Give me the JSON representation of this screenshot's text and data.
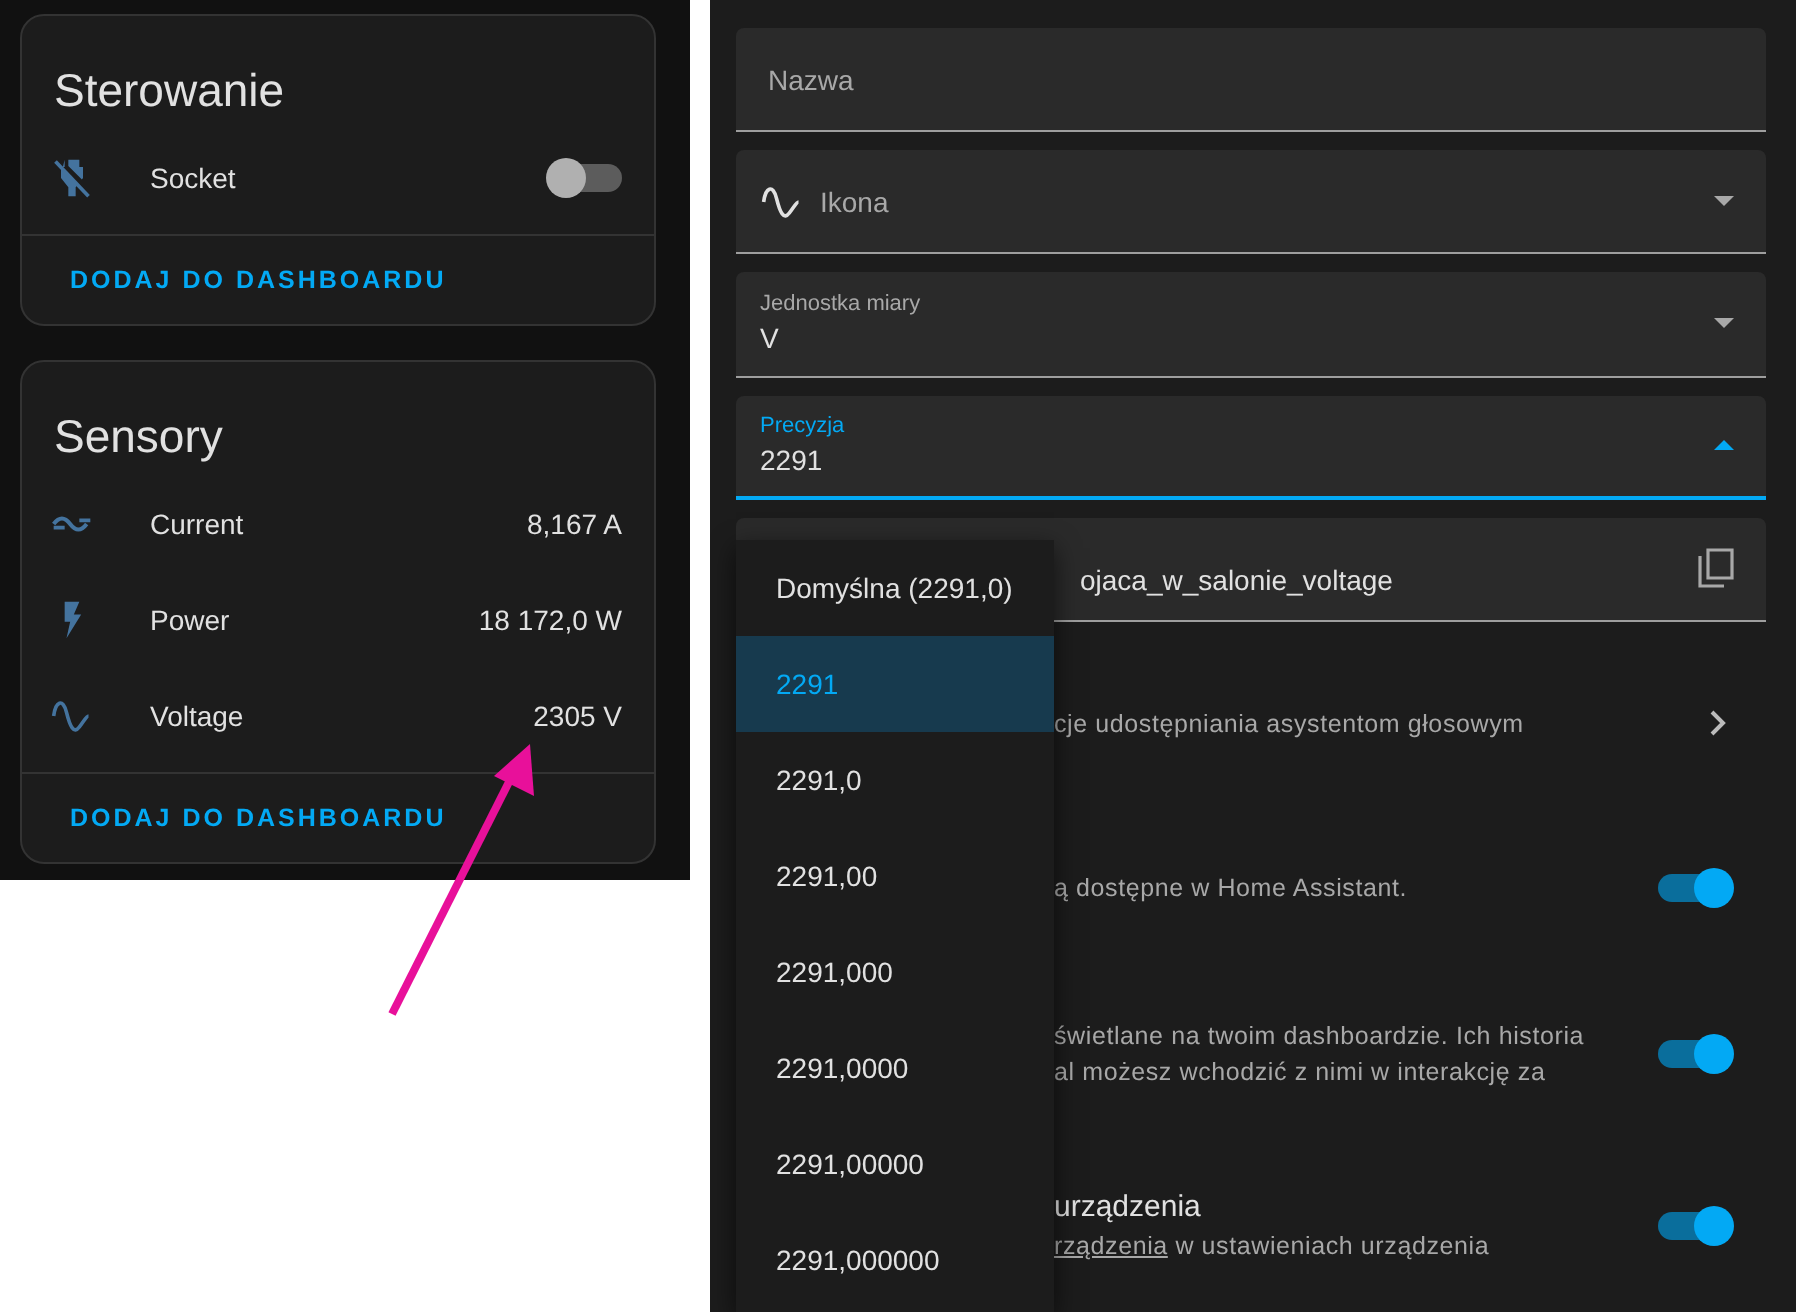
{
  "cards": [
    {
      "title": "Sterowanie",
      "rows": [
        {
          "kind": "toggle",
          "name": "Socket",
          "on": false
        }
      ],
      "action": "DODAJ DO DASHBOARDU"
    },
    {
      "title": "Sensory",
      "rows": [
        {
          "kind": "value",
          "name": "Current",
          "value": "8,167 A"
        },
        {
          "kind": "value",
          "name": "Power",
          "value": "18 172,0 W"
        },
        {
          "kind": "value",
          "name": "Voltage",
          "value": "2305 V"
        }
      ],
      "action": "DODAJ DO DASHBOARDU"
    }
  ],
  "fields": [
    {
      "kind": "text",
      "placeholder": "Nazwa"
    },
    {
      "kind": "icon-select",
      "label": "Ikona"
    },
    {
      "kind": "select",
      "label": "Jednostka miary",
      "value": "V",
      "expanded": false
    },
    {
      "kind": "select",
      "label": "Precyzja",
      "value": "2291",
      "expanded": true
    },
    {
      "kind": "copy",
      "value": "ojaca_w_salonie_voltage"
    }
  ],
  "menu": [
    {
      "label": "Domyślna (2291,0)",
      "selected": false
    },
    {
      "label": "2291",
      "selected": true
    },
    {
      "label": "2291,0",
      "selected": false
    },
    {
      "label": "2291,00",
      "selected": false
    },
    {
      "label": "2291,000",
      "selected": false
    },
    {
      "label": "2291,0000",
      "selected": false
    },
    {
      "label": "2291,00000",
      "selected": false
    },
    {
      "label": "2291,000000",
      "selected": false
    }
  ],
  "settings": [
    {
      "kind": "link",
      "lines": [
        "cje udostępniania asystentom głosowym"
      ]
    },
    {
      "kind": "toggle",
      "on": true,
      "lines": [
        "ą dostępne w Home Assistant."
      ]
    },
    {
      "kind": "toggle",
      "on": true,
      "lines": [
        "świetlane na twoim dashboardzie. Ich historia",
        "al możesz wchodzić z nimi w interakcję za"
      ]
    },
    {
      "kind": "toggle",
      "on": true,
      "title": "urządzenia",
      "link": "rządzenia",
      "lines": [
        "w ustawieniach urządzenia"
      ]
    }
  ]
}
